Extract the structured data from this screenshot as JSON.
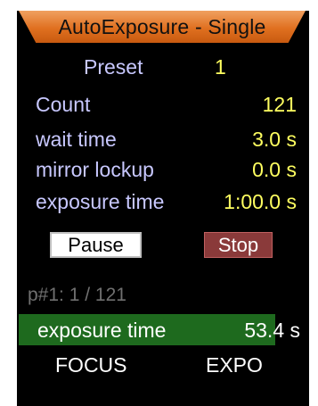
{
  "title": "AutoExposure - Single",
  "preset": {
    "label": "Preset",
    "value": "1"
  },
  "settings": [
    {
      "label": "Count",
      "value": "121"
    },
    {
      "label": "wait time",
      "value": "3.0 s"
    },
    {
      "label": "mirror lockup",
      "value": "0.0 s"
    },
    {
      "label": "exposure time",
      "value": "1:00.0 s"
    }
  ],
  "buttons": {
    "pause": "Pause",
    "stop": "Stop"
  },
  "progress": {
    "status": "p#1: 1 / 121",
    "bar_label": "exposure time",
    "bar_value": "53.4 s",
    "fraction": 0.89
  },
  "softkeys": {
    "left": "FOCUS",
    "right": "EXPO"
  },
  "colors": {
    "title_bar": "#e07020",
    "label_text": "#c8c8ff",
    "value_text": "#ffff60",
    "progress_fill": "#1e6a1e",
    "stop_button": "#8a3a3a"
  }
}
